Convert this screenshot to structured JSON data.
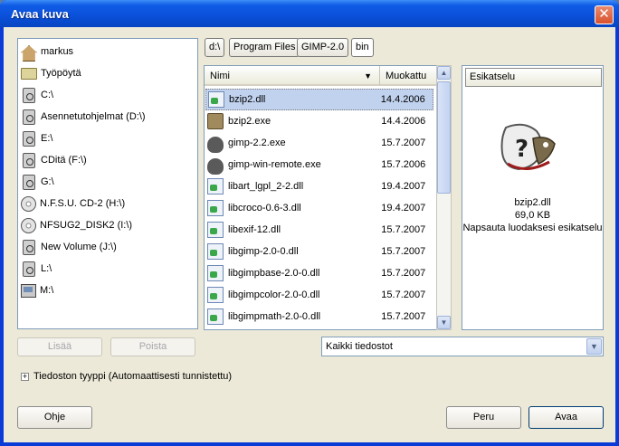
{
  "window": {
    "title": "Avaa kuva",
    "close_glyph": "✕"
  },
  "places": [
    {
      "label": "markus",
      "icon": "home-icon"
    },
    {
      "label": "Työpöytä",
      "icon": "folder-icon"
    },
    {
      "label": "C:\\",
      "icon": "drive-icon"
    },
    {
      "label": "Asennetutohjelmat (D:\\)",
      "icon": "drive-icon"
    },
    {
      "label": "E:\\",
      "icon": "drive-icon"
    },
    {
      "label": "CDitä (F:\\)",
      "icon": "drive-icon"
    },
    {
      "label": "G:\\",
      "icon": "drive-icon"
    },
    {
      "label": "N.F.S.U. CD-2 (H:\\)",
      "icon": "cd-icon"
    },
    {
      "label": "NFSUG2_DISK2 (I:\\)",
      "icon": "cd-icon"
    },
    {
      "label": "New Volume (J:\\)",
      "icon": "drive-icon"
    },
    {
      "label": "L:\\",
      "icon": "drive-icon"
    },
    {
      "label": "M:\\",
      "icon": "network-drive-icon"
    }
  ],
  "places_buttons": {
    "add": "Lisää",
    "remove": "Poista"
  },
  "path": [
    "d:\\",
    "Program Files",
    "GIMP-2.0",
    "bin"
  ],
  "columns": {
    "name": "Nimi",
    "modified": "Muokattu",
    "sort_glyph": "▼"
  },
  "files": [
    {
      "name": "bzip2.dll",
      "date": "14.4.2006",
      "icon": "dll-file-icon",
      "selected": true
    },
    {
      "name": "bzip2.exe",
      "date": "14.4.2006",
      "icon": "exe-file-icon"
    },
    {
      "name": "gimp-2.2.exe",
      "date": "15.7.2007",
      "icon": "gimp-exe-icon"
    },
    {
      "name": "gimp-win-remote.exe",
      "date": "15.7.2006",
      "icon": "gimp-exe-icon"
    },
    {
      "name": "libart_lgpl_2-2.dll",
      "date": "19.4.2007",
      "icon": "dll-file-icon"
    },
    {
      "name": "libcroco-0.6-3.dll",
      "date": "19.4.2007",
      "icon": "dll-file-icon"
    },
    {
      "name": "libexif-12.dll",
      "date": "15.7.2007",
      "icon": "dll-file-icon"
    },
    {
      "name": "libgimp-2.0-0.dll",
      "date": "15.7.2007",
      "icon": "dll-file-icon"
    },
    {
      "name": "libgimpbase-2.0-0.dll",
      "date": "15.7.2007",
      "icon": "dll-file-icon"
    },
    {
      "name": "libgimpcolor-2.0-0.dll",
      "date": "15.7.2007",
      "icon": "dll-file-icon"
    },
    {
      "name": "libgimpmath-2.0-0.dll",
      "date": "15.7.2007",
      "icon": "dll-file-icon"
    }
  ],
  "preview": {
    "header": "Esikatselu",
    "filename": "bzip2.dll",
    "size": "69,0 KB",
    "hint": "Napsauta luodaksesi esikatselu",
    "icon": "gimp-unknown-file-icon"
  },
  "filter": {
    "selected": "Kaikki tiedostot"
  },
  "file_type": {
    "label": "Tiedoston tyyppi (Automaattisesti tunnistettu)"
  },
  "buttons": {
    "help": "Ohje",
    "cancel": "Peru",
    "open": "Avaa"
  },
  "colors": {
    "titlebar": "#0a4fd9",
    "selection": "#c1d2ee",
    "dialog_bg": "#ece9d8"
  }
}
